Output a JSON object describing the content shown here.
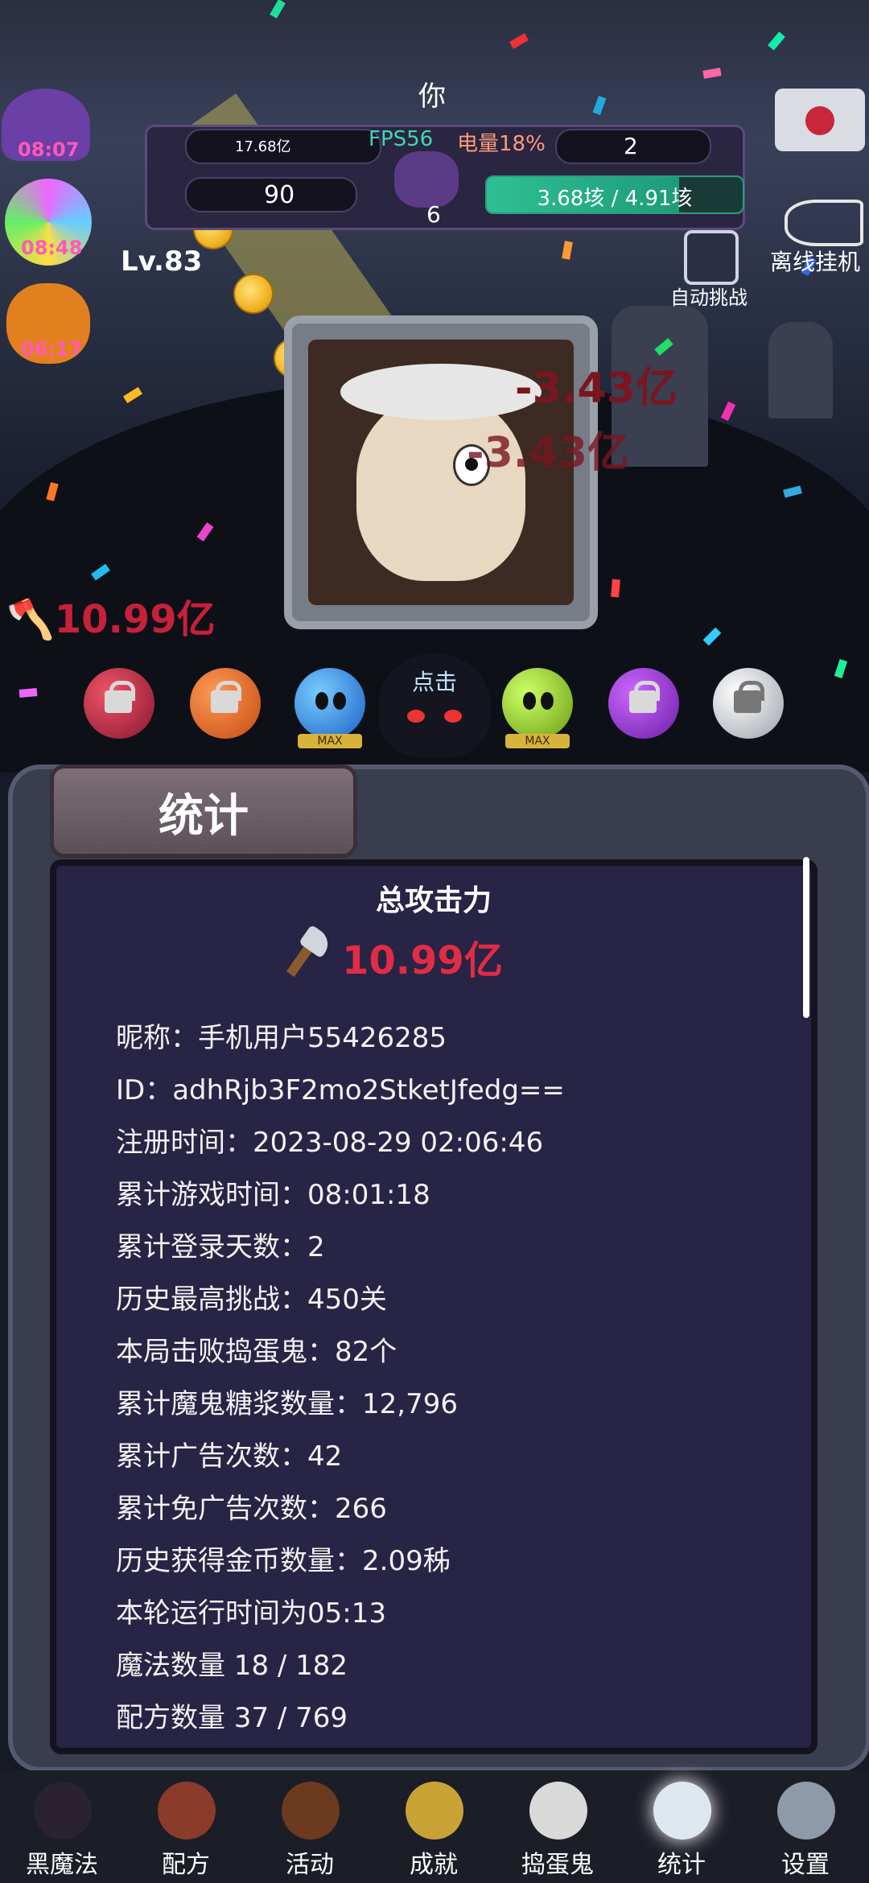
{
  "header": {
    "player_name": "你",
    "gold": "17.68亿",
    "fps": "FPS56",
    "battery": "电量18%",
    "gems": "2",
    "candy": "90",
    "cauldron": "6",
    "hp_text": "3.68垓 / 4.91垓",
    "hp_fraction": 0.75,
    "level": "Lv.83",
    "timers": [
      "08:07",
      "08:48",
      "06:17"
    ],
    "auto_challenge": "自动挑战",
    "offline": "离线挂机"
  },
  "battle": {
    "damage_numbers": [
      "-3.43亿",
      "-3.43亿"
    ],
    "attack_float": "10.99亿",
    "click_label": "点击",
    "max_tag": "MAX"
  },
  "panel": {
    "tab_title": "统计",
    "total_title": "总攻击力",
    "total_value": "10.99亿",
    "lines": [
      "昵称：手机用户55426285",
      "ID：adhRjb3F2mo2StketJfedg==",
      "注册时间：2023-08-29 02:06:46",
      "累计游戏时间：08:01:18",
      "累计登录天数：2",
      "历史最高挑战：450关",
      "本局击败捣蛋鬼：82个",
      "累计魔鬼糖浆数量：12,796",
      "累计广告次数：42",
      "累计免广告次数：266",
      "历史获得金币数量：2.09秭",
      "本轮运行时间为05:13",
      "魔法数量 18 / 182",
      "配方数量 37 / 769"
    ]
  },
  "nav": [
    {
      "label": "黑魔法",
      "icon": "black-magic-icon",
      "color": "#2b2230"
    },
    {
      "label": "配方",
      "icon": "recipe-book-icon",
      "color": "#8a3b2a"
    },
    {
      "label": "活动",
      "icon": "event-icon",
      "color": "#6b3a1f"
    },
    {
      "label": "成就",
      "icon": "skull-trophy-icon",
      "color": "#c8a235"
    },
    {
      "label": "捣蛋鬼",
      "icon": "ghost-icon",
      "color": "#d9d9d9"
    },
    {
      "label": "统计",
      "icon": "crystal-ball-icon",
      "color": "#dfe7ee"
    },
    {
      "label": "设置",
      "icon": "gear-icon",
      "color": "#8e9aa8"
    }
  ],
  "colors": {
    "accent_red": "#e02c44",
    "panel_bg": "#272445",
    "hp_green": "#2fbf93"
  }
}
